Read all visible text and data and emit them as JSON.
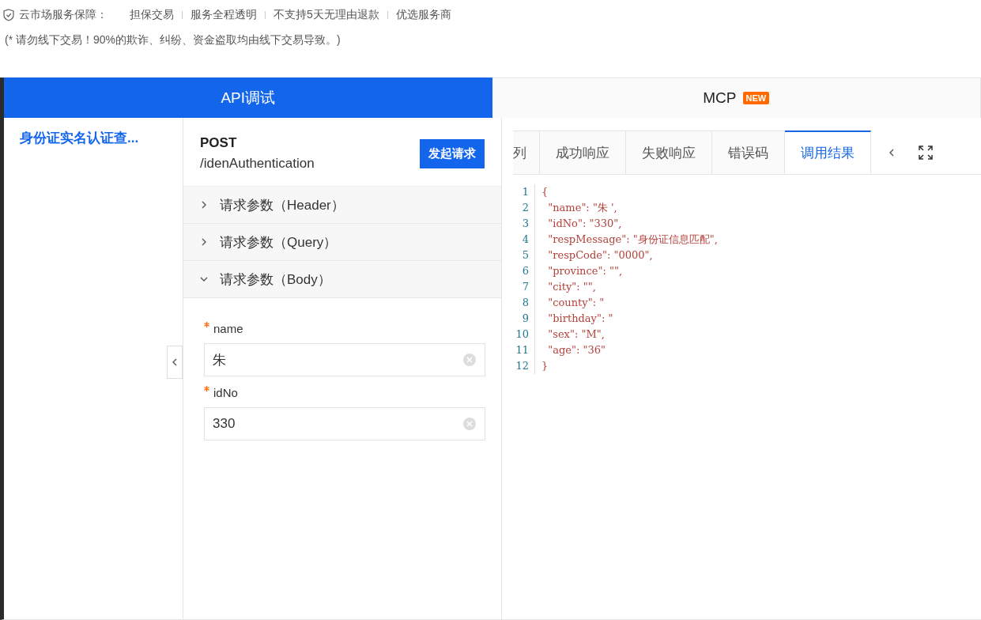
{
  "guarantee": {
    "title": "云市场服务保障：",
    "items": [
      "担保交易",
      "服务全程透明",
      "不支持5天无理由退款",
      "优选服务商"
    ]
  },
  "warning": "(* 请勿线下交易！90%的欺诈、纠纷、资金盗取均由线下交易导致。)",
  "main_tabs": [
    {
      "label": "API调试",
      "selected": true
    },
    {
      "label": "MCP",
      "selected": false,
      "badge": "NEW"
    }
  ],
  "sidebar": {
    "items": [
      {
        "label": "身份证实名认证查...",
        "selected": true
      }
    ]
  },
  "request": {
    "method": "POST",
    "path": "/idenAuthentication",
    "send_button": "发起请求",
    "sections": [
      {
        "label": "请求参数（Header）",
        "expanded": false
      },
      {
        "label": "请求参数（Query）",
        "expanded": false
      },
      {
        "label": "请求参数（Body）",
        "expanded": true
      }
    ],
    "fields": [
      {
        "label": "name",
        "required": true,
        "value": "朱"
      },
      {
        "label": "idNo",
        "required": true,
        "value": "330"
      }
    ]
  },
  "result_tabs": [
    {
      "label": "列",
      "selected": false
    },
    {
      "label": "成功响应",
      "selected": false
    },
    {
      "label": "失败响应",
      "selected": false
    },
    {
      "label": "错误码",
      "selected": false
    },
    {
      "label": "调用结果",
      "selected": true
    }
  ],
  "code_lines": [
    {
      "number": "1",
      "text": "{"
    },
    {
      "number": "2",
      "text": "  \"name\": \"朱 ',"
    },
    {
      "number": "3",
      "text": "  \"idNo\": \"330\","
    },
    {
      "number": "4",
      "text": "  \"respMessage\": \"身份证信息匹配\","
    },
    {
      "number": "5",
      "text": "  \"respCode\": \"0000\","
    },
    {
      "number": "6",
      "text": "  \"province\": \"\","
    },
    {
      "number": "7",
      "text": "  \"city\": \"\","
    },
    {
      "number": "8",
      "text": "  \"county\": \""
    },
    {
      "number": "9",
      "text": "  \"birthday\": \""
    },
    {
      "number": "10",
      "text": "  \"sex\": \"M\","
    },
    {
      "number": "11",
      "text": "  \"age\": \"36\""
    },
    {
      "number": "12",
      "text": "}"
    }
  ]
}
